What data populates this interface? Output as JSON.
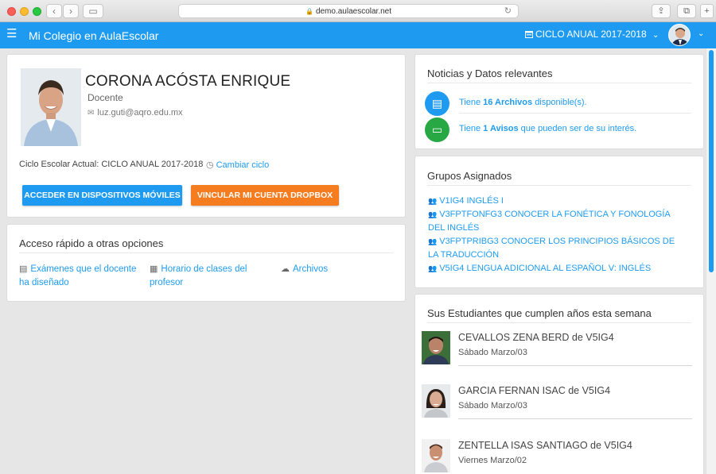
{
  "browser": {
    "url": "demo.aulaescolar.net",
    "back_glyph": "‹",
    "forward_glyph": "›",
    "sidebar_glyph": "▭",
    "share_glyph": "⇪",
    "tabs_glyph": "⧉",
    "plus_glyph": "+",
    "lock_glyph": "🔒",
    "reload_glyph": "↻"
  },
  "header": {
    "menu_glyph": "☰",
    "title": "Mi Colegio en AulaEscolar",
    "cycle_icon": "calendar-icon",
    "cycle_label": "CICLO ANUAL 2017-2018",
    "cycle_caret": "⌄",
    "user_caret": "⌄",
    "brand_color": "#1e9bf0"
  },
  "profile": {
    "name": "CORONA ACÓSTA ENRIQUE",
    "role": "Docente",
    "email": "luz.guti@aqro.edu.mx",
    "email_glyph": "✉",
    "ciclo_text": "Ciclo Escolar Actual: CICLO ANUAL 2017-2018",
    "clock_glyph": "◷",
    "change_cycle": "Cambiar ciclo",
    "btn_mobile": "ACCEDER EN DISPOSITIVOS MÓVILES",
    "btn_dropbox": "VINCULAR MI CUENTA DROPBOX"
  },
  "quick_access": {
    "title": "Acceso rápido a otras opciones",
    "links": [
      {
        "glyph": "▤",
        "label": "Exámenes que el docente ha diseñado"
      },
      {
        "glyph": "▦",
        "label": "Horario de clases del profesor"
      },
      {
        "glyph": "☁",
        "label": "Archivos"
      }
    ]
  },
  "news": {
    "title": "Noticias y Datos relevantes",
    "items": [
      {
        "icon": "document-icon",
        "glyph": "▤",
        "color": "#1e9bf0",
        "pre": "Tiene ",
        "bold": "16 Archivos",
        "post": " disponible(s)."
      },
      {
        "icon": "chat-icon",
        "glyph": "▭",
        "color": "#27a844",
        "pre": "Tiene ",
        "bold": "1 Avisos",
        "post": " que pueden ser de su interés."
      }
    ]
  },
  "groups": {
    "title": "Grupos Asignados",
    "glyph": "👥",
    "items": [
      "V1IG4 INGLÉS I",
      "V3FPTFONFG3 CONOCER LA FONÉTICA Y FONOLOGÍA DEL INGLÉS",
      "V3FPTPRIBG3 CONOCER LOS PRINCIPIOS BÁSICOS DE LA TRADUCCIÓN",
      "V5IG4 LENGUA ADICIONAL AL ESPAÑOL V: INGLÉS"
    ]
  },
  "birthdays": {
    "title": "Sus Estudiantes que cumplen años esta semana",
    "items": [
      {
        "name": "CEVALLOS ZENA BERD  de V5IG4",
        "date": "Sábado Marzo/03"
      },
      {
        "name": "GARCIA FERNAN ISAC de V5IG4",
        "date": "Sábado Marzo/03"
      },
      {
        "name": "ZENTELLA ISAS SANTIAGO de V5IG4",
        "date": "Viernes Marzo/02"
      }
    ]
  }
}
